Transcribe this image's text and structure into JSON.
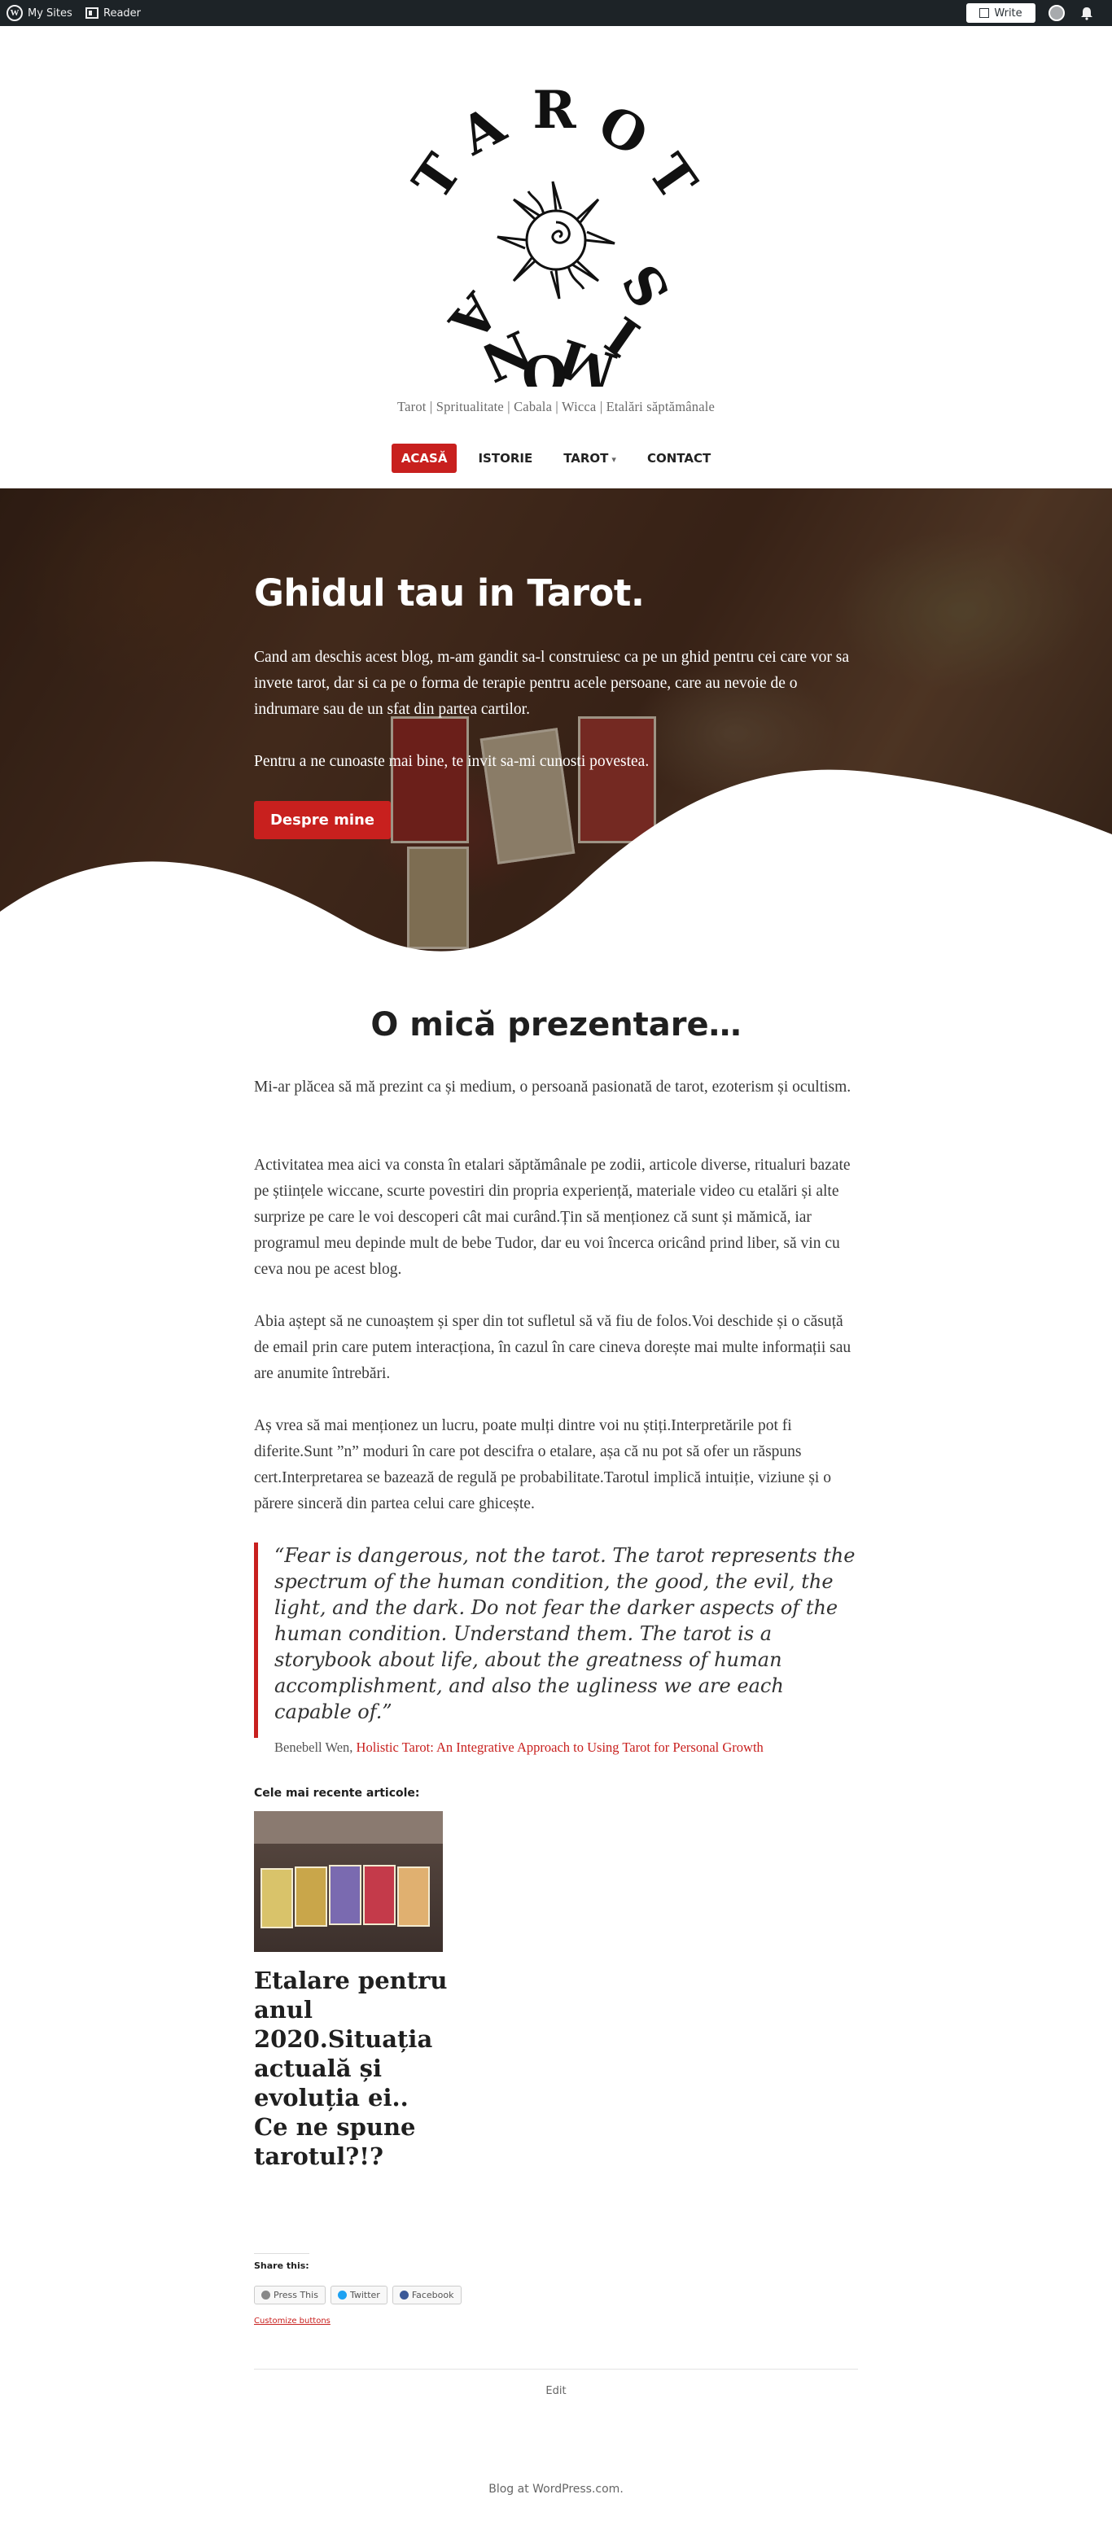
{
  "adminbar": {
    "my_sites": "My Sites",
    "reader": "Reader",
    "write": "Write"
  },
  "site": {
    "logo_text": "TAROT SIMONA",
    "tagline": "Tarot | Spritualitate | Cabala | Wicca | Etalări săptămânale"
  },
  "nav": {
    "items": [
      {
        "label": "ACASĂ"
      },
      {
        "label": "ISTORIE"
      },
      {
        "label": "TAROT"
      },
      {
        "label": "CONTACT"
      }
    ],
    "dropdown_caret": "▾"
  },
  "hero": {
    "title": "Ghidul tau in Tarot.",
    "paragraph1": "Cand am deschis acest blog, m-am gandit sa-l construiesc ca pe un ghid pentru cei care vor sa invete tarot, dar si ca pe o forma de terapie pentru acele persoane, care au nevoie de o indrumare sau de un sfat din partea cartilor.",
    "paragraph2": "Pentru a ne cunoaste mai bine, te invit sa-mi cunosti povestea.",
    "button": "Despre mine"
  },
  "content": {
    "title": "O mică prezentare…",
    "paragraphs": [
      "Mi-ar plăcea să mă prezint ca și medium, o persoană pasionată de tarot, ezoterism și ocultism.",
      "Activitatea mea aici va consta în etalari săptămânale pe zodii, articole diverse, ritualuri bazate pe științele wiccane, scurte povestiri din propria experiență, materiale video cu etalări și alte surprize pe care le voi descoperi cât mai curând.Țin să menționez că sunt și mămică, iar programul meu depinde mult de bebe Tudor, dar eu voi încerca oricând prind liber, să vin cu ceva nou pe acest blog.",
      "Abia aștept să ne cunoaștem și sper din tot sufletul să vă fiu de folos.Voi deschide și o căsuță de email prin care putem interacționa, în cazul în care cineva dorește mai multe informații sau are anumite întrebări.",
      "Aș vrea să mai menționez un lucru, poate mulți dintre voi nu știți.Interpretările pot fi diferite.Sunt ”n” moduri în care pot descifra o etalare, așa că nu pot să ofer un răspuns cert.Interpretarea se bazează de regulă pe probabilitate.Tarotul implică intuiție, viziune și o părere sinceră din partea celui care ghicește."
    ],
    "quote": "“Fear is dangerous, not the tarot. The tarot represents the spectrum of the human condition, the good, the evil, the light, and the dark. Do not fear the darker aspects of the human condition. Understand them. The tarot is a storybook about life, about the greatness of human accomplishment, and also the ugliness we are each capable of.”",
    "quote_author": "Benebell Wen, ",
    "quote_source": "Holistic Tarot: An Integrative Approach to Using Tarot for Personal Growth"
  },
  "recent": {
    "label": "Cele mai recente articole:",
    "post_title": "Etalare pentru anul 2020.Situația actuală și evoluția ei.. Ce ne spune tarotul?!?"
  },
  "share": {
    "label": "Share this:",
    "buttons": [
      "Press This",
      "Twitter",
      "Facebook"
    ],
    "customize": "Customize buttons"
  },
  "edit": "Edit",
  "footer": "Blog at WordPress.com.",
  "colors": {
    "accent": "#c8201e",
    "adminbar": "#1d2327"
  }
}
